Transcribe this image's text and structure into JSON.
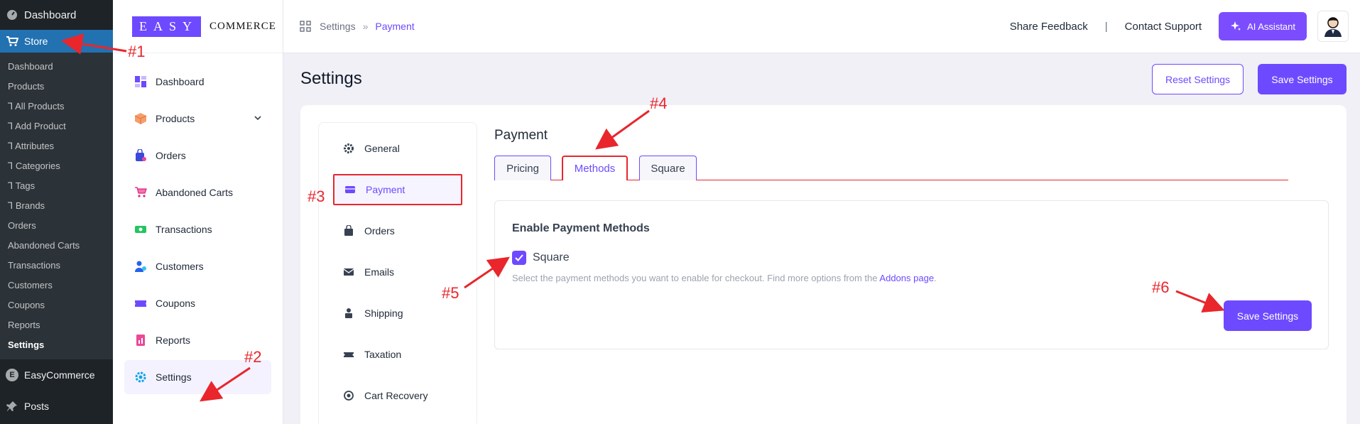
{
  "wp_sidebar": {
    "top_item": "Dashboard",
    "store_item": "Store",
    "submenu": [
      "Dashboard",
      "Products",
      "Ꞁ All Products",
      "Ꞁ Add Product",
      "Ꞁ Attributes",
      "Ꞁ Categories",
      "Ꞁ Tags",
      "Ꞁ Brands",
      "Orders",
      "Abandoned Carts",
      "Transactions",
      "Customers",
      "Coupons",
      "Reports",
      "Settings"
    ],
    "easycommerce": "EasyCommerce",
    "posts": "Posts",
    "badge_letter": "E"
  },
  "logo": {
    "boxed": "EASY",
    "text": "COMMERCE"
  },
  "plugin_nav": [
    "Dashboard",
    "Products",
    "Orders",
    "Abandoned Carts",
    "Transactions",
    "Customers",
    "Coupons",
    "Reports",
    "Settings"
  ],
  "breadcrumb": {
    "parent": "Settings",
    "separator": "»",
    "current": "Payment"
  },
  "topbar": {
    "share_feedback": "Share Feedback",
    "pipe": "|",
    "contact_support": "Contact Support",
    "ai_assistant": "AI Assistant"
  },
  "page": {
    "title": "Settings",
    "reset_button": "Reset Settings",
    "save_button": "Save Settings"
  },
  "settings_nav": [
    "General",
    "Payment",
    "Orders",
    "Emails",
    "Shipping",
    "Taxation",
    "Cart Recovery"
  ],
  "section": {
    "title": "Payment",
    "tabs": [
      "Pricing",
      "Methods",
      "Square"
    ]
  },
  "payment_methods": {
    "title": "Enable Payment Methods",
    "checkbox_label": "Square",
    "help_text": "Select the payment methods you want to enable for checkout. Find more options from the",
    "help_link": "Addons page",
    "help_end": ".",
    "save_button": "Save Settings"
  },
  "annotations": [
    "#1",
    "#2",
    "#3",
    "#4",
    "#5",
    "#6"
  ],
  "colors": {
    "accent": "#6d4aff",
    "annotation": "#e8262c",
    "wp_sidebar": "#1d2327",
    "wp_active": "#2271b1"
  }
}
